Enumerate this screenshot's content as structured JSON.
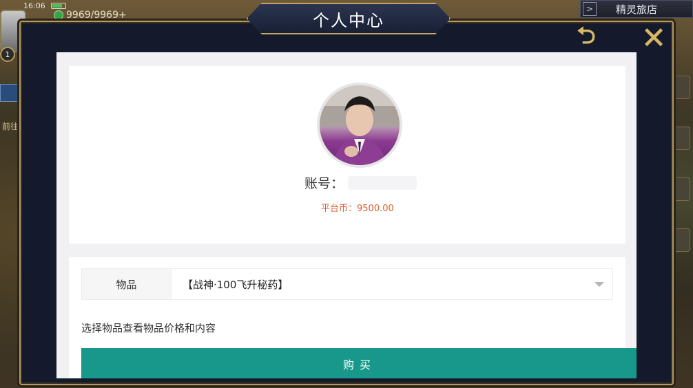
{
  "status": {
    "time": "16:06",
    "energy": "9969/9969+"
  },
  "game": {
    "top_right_label": "精灵旅店",
    "level_badge": "1",
    "side_text": "前往"
  },
  "modal": {
    "title": "个人中心",
    "back_icon": "back-arrow-icon",
    "close_icon": "close-x-icon"
  },
  "profile": {
    "account_label": "账号：",
    "account_value": "",
    "coins_label": "平台币：",
    "coins_value": "9500.00"
  },
  "purchase": {
    "item_label": "物品",
    "item_selected": "【战神·100飞升秘药】",
    "hint": "选择物品查看物品价格和内容",
    "buy_label": "购买"
  },
  "colors": {
    "accent": "#17988a",
    "coins": "#d9602d",
    "frame_gold": "#b69a5e"
  }
}
